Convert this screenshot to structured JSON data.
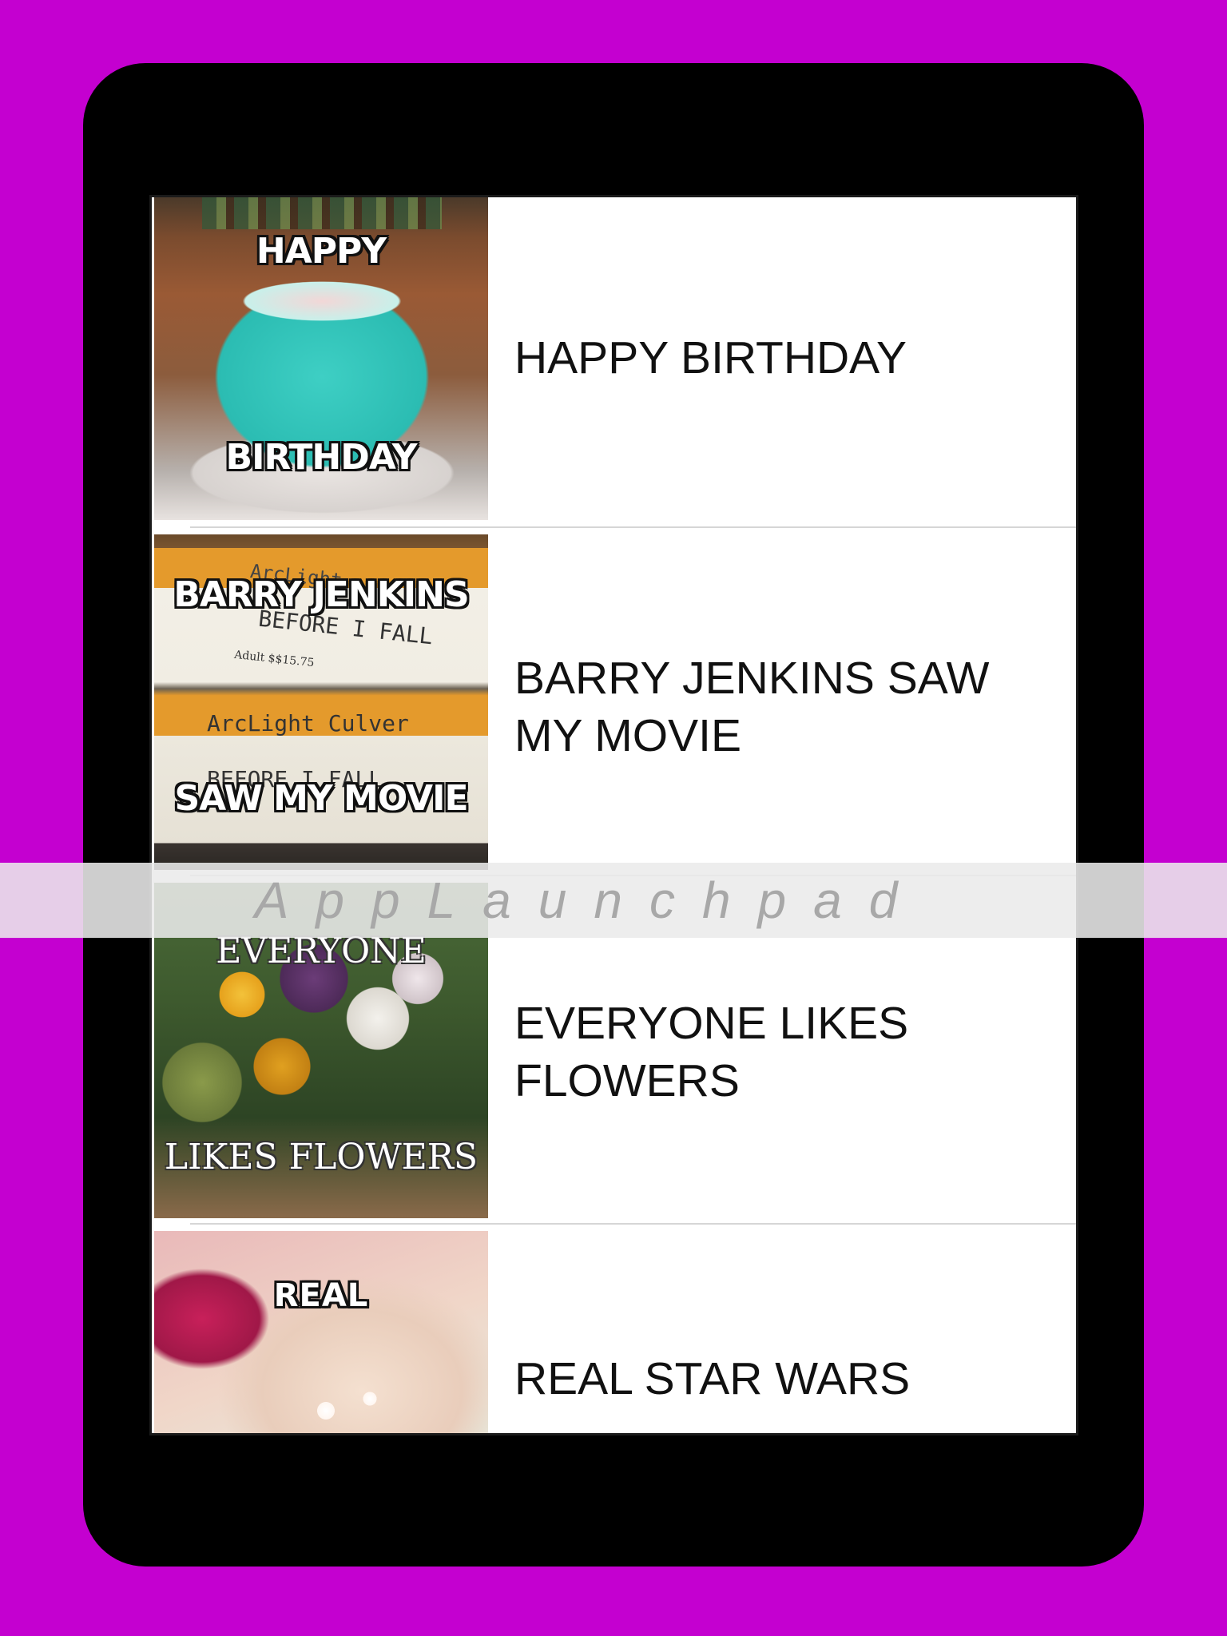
{
  "watermark": {
    "text": "AppLaunchpad"
  },
  "list": {
    "items": [
      {
        "title": "HAPPY BIRTHDAY",
        "caption_top": "HAPPY",
        "caption_bottom": "BIRTHDAY"
      },
      {
        "title_lines": [
          "BARRY JENKINS SAW",
          "MY MOVIE"
        ],
        "caption_top": "BARRY JENKINS",
        "caption_bottom": "SAW MY MOVIE",
        "photo_text": [
          "ArcLight",
          "BEFORE I FALL",
          "Adult $$15.75",
          "ArcLight Culver",
          "BEFORE I FALL"
        ]
      },
      {
        "title_lines": [
          "EVERYONE LIKES",
          "FLOWERS"
        ],
        "caption_top": "EVERYONE",
        "caption_bottom": "LIKES FLOWERS"
      },
      {
        "title": "REAL STAR WARS",
        "caption_top": "REAL"
      }
    ]
  },
  "colors": {
    "background": "#c400d0",
    "device": "#000000",
    "separator": "#d6d6d6"
  }
}
